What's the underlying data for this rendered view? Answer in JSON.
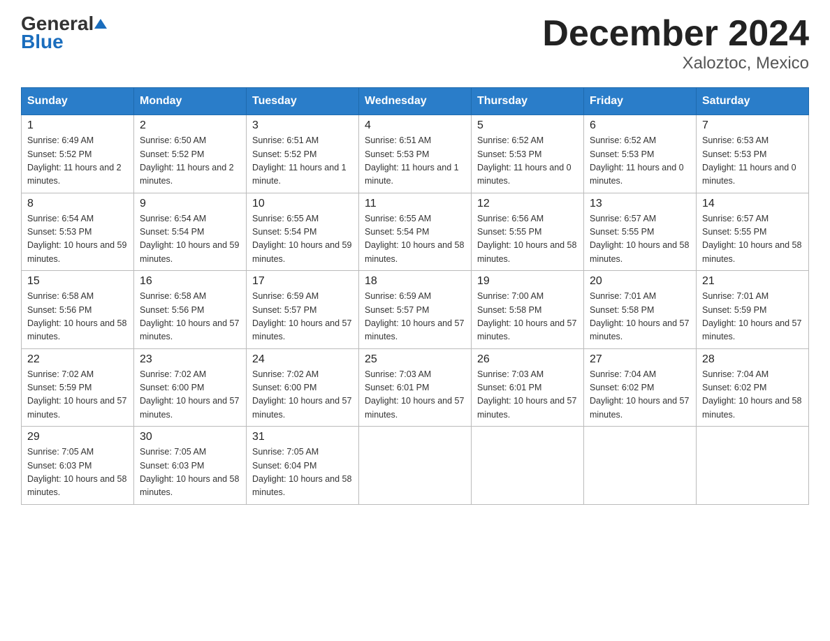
{
  "header": {
    "logo": {
      "general": "General",
      "triangle_symbol": "▲",
      "blue": "Blue"
    },
    "title": "December 2024",
    "subtitle": "Xaloztoc, Mexico"
  },
  "calendar": {
    "days_of_week": [
      "Sunday",
      "Monday",
      "Tuesday",
      "Wednesday",
      "Thursday",
      "Friday",
      "Saturday"
    ],
    "weeks": [
      [
        {
          "day": "1",
          "sunrise": "6:49 AM",
          "sunset": "5:52 PM",
          "daylight": "11 hours and 2 minutes."
        },
        {
          "day": "2",
          "sunrise": "6:50 AM",
          "sunset": "5:52 PM",
          "daylight": "11 hours and 2 minutes."
        },
        {
          "day": "3",
          "sunrise": "6:51 AM",
          "sunset": "5:52 PM",
          "daylight": "11 hours and 1 minute."
        },
        {
          "day": "4",
          "sunrise": "6:51 AM",
          "sunset": "5:53 PM",
          "daylight": "11 hours and 1 minute."
        },
        {
          "day": "5",
          "sunrise": "6:52 AM",
          "sunset": "5:53 PM",
          "daylight": "11 hours and 0 minutes."
        },
        {
          "day": "6",
          "sunrise": "6:52 AM",
          "sunset": "5:53 PM",
          "daylight": "11 hours and 0 minutes."
        },
        {
          "day": "7",
          "sunrise": "6:53 AM",
          "sunset": "5:53 PM",
          "daylight": "11 hours and 0 minutes."
        }
      ],
      [
        {
          "day": "8",
          "sunrise": "6:54 AM",
          "sunset": "5:53 PM",
          "daylight": "10 hours and 59 minutes."
        },
        {
          "day": "9",
          "sunrise": "6:54 AM",
          "sunset": "5:54 PM",
          "daylight": "10 hours and 59 minutes."
        },
        {
          "day": "10",
          "sunrise": "6:55 AM",
          "sunset": "5:54 PM",
          "daylight": "10 hours and 59 minutes."
        },
        {
          "day": "11",
          "sunrise": "6:55 AM",
          "sunset": "5:54 PM",
          "daylight": "10 hours and 58 minutes."
        },
        {
          "day": "12",
          "sunrise": "6:56 AM",
          "sunset": "5:55 PM",
          "daylight": "10 hours and 58 minutes."
        },
        {
          "day": "13",
          "sunrise": "6:57 AM",
          "sunset": "5:55 PM",
          "daylight": "10 hours and 58 minutes."
        },
        {
          "day": "14",
          "sunrise": "6:57 AM",
          "sunset": "5:55 PM",
          "daylight": "10 hours and 58 minutes."
        }
      ],
      [
        {
          "day": "15",
          "sunrise": "6:58 AM",
          "sunset": "5:56 PM",
          "daylight": "10 hours and 58 minutes."
        },
        {
          "day": "16",
          "sunrise": "6:58 AM",
          "sunset": "5:56 PM",
          "daylight": "10 hours and 57 minutes."
        },
        {
          "day": "17",
          "sunrise": "6:59 AM",
          "sunset": "5:57 PM",
          "daylight": "10 hours and 57 minutes."
        },
        {
          "day": "18",
          "sunrise": "6:59 AM",
          "sunset": "5:57 PM",
          "daylight": "10 hours and 57 minutes."
        },
        {
          "day": "19",
          "sunrise": "7:00 AM",
          "sunset": "5:58 PM",
          "daylight": "10 hours and 57 minutes."
        },
        {
          "day": "20",
          "sunrise": "7:01 AM",
          "sunset": "5:58 PM",
          "daylight": "10 hours and 57 minutes."
        },
        {
          "day": "21",
          "sunrise": "7:01 AM",
          "sunset": "5:59 PM",
          "daylight": "10 hours and 57 minutes."
        }
      ],
      [
        {
          "day": "22",
          "sunrise": "7:02 AM",
          "sunset": "5:59 PM",
          "daylight": "10 hours and 57 minutes."
        },
        {
          "day": "23",
          "sunrise": "7:02 AM",
          "sunset": "6:00 PM",
          "daylight": "10 hours and 57 minutes."
        },
        {
          "day": "24",
          "sunrise": "7:02 AM",
          "sunset": "6:00 PM",
          "daylight": "10 hours and 57 minutes."
        },
        {
          "day": "25",
          "sunrise": "7:03 AM",
          "sunset": "6:01 PM",
          "daylight": "10 hours and 57 minutes."
        },
        {
          "day": "26",
          "sunrise": "7:03 AM",
          "sunset": "6:01 PM",
          "daylight": "10 hours and 57 minutes."
        },
        {
          "day": "27",
          "sunrise": "7:04 AM",
          "sunset": "6:02 PM",
          "daylight": "10 hours and 57 minutes."
        },
        {
          "day": "28",
          "sunrise": "7:04 AM",
          "sunset": "6:02 PM",
          "daylight": "10 hours and 58 minutes."
        }
      ],
      [
        {
          "day": "29",
          "sunrise": "7:05 AM",
          "sunset": "6:03 PM",
          "daylight": "10 hours and 58 minutes."
        },
        {
          "day": "30",
          "sunrise": "7:05 AM",
          "sunset": "6:03 PM",
          "daylight": "10 hours and 58 minutes."
        },
        {
          "day": "31",
          "sunrise": "7:05 AM",
          "sunset": "6:04 PM",
          "daylight": "10 hours and 58 minutes."
        },
        null,
        null,
        null,
        null
      ]
    ]
  }
}
